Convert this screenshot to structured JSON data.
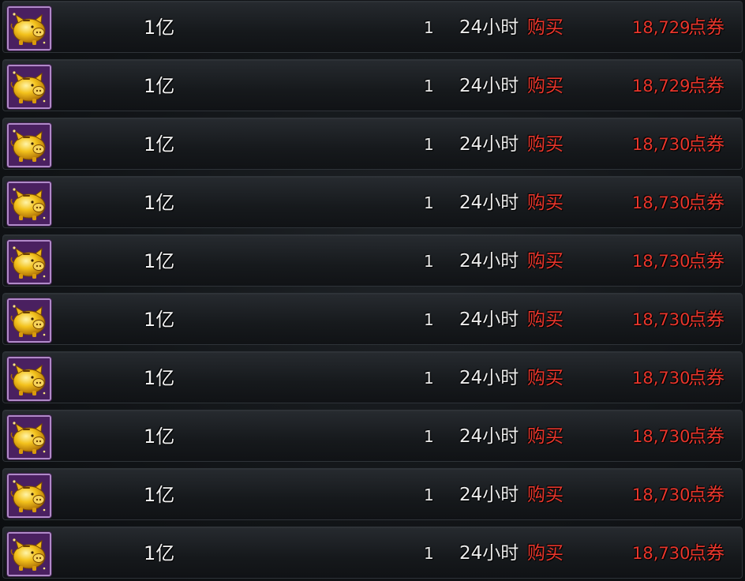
{
  "colors": {
    "accent": "#e8362c",
    "text": "#f2f2f2",
    "icon_border": "#b089c8"
  },
  "rows": [
    {
      "icon": "golden-pig-icon",
      "name": "1亿",
      "quantity": "1",
      "duration": "24小时",
      "buy_label": "购买",
      "price": "18,729",
      "currency": "点券"
    },
    {
      "icon": "golden-pig-icon",
      "name": "1亿",
      "quantity": "1",
      "duration": "24小时",
      "buy_label": "购买",
      "price": "18,729",
      "currency": "点券"
    },
    {
      "icon": "golden-pig-icon",
      "name": "1亿",
      "quantity": "1",
      "duration": "24小时",
      "buy_label": "购买",
      "price": "18,730",
      "currency": "点券"
    },
    {
      "icon": "golden-pig-icon",
      "name": "1亿",
      "quantity": "1",
      "duration": "24小时",
      "buy_label": "购买",
      "price": "18,730",
      "currency": "点券"
    },
    {
      "icon": "golden-pig-icon",
      "name": "1亿",
      "quantity": "1",
      "duration": "24小时",
      "buy_label": "购买",
      "price": "18,730",
      "currency": "点券"
    },
    {
      "icon": "golden-pig-icon",
      "name": "1亿",
      "quantity": "1",
      "duration": "24小时",
      "buy_label": "购买",
      "price": "18,730",
      "currency": "点券"
    },
    {
      "icon": "golden-pig-icon",
      "name": "1亿",
      "quantity": "1",
      "duration": "24小时",
      "buy_label": "购买",
      "price": "18,730",
      "currency": "点券"
    },
    {
      "icon": "golden-pig-icon",
      "name": "1亿",
      "quantity": "1",
      "duration": "24小时",
      "buy_label": "购买",
      "price": "18,730",
      "currency": "点券"
    },
    {
      "icon": "golden-pig-icon",
      "name": "1亿",
      "quantity": "1",
      "duration": "24小时",
      "buy_label": "购买",
      "price": "18,730",
      "currency": "点券"
    },
    {
      "icon": "golden-pig-icon",
      "name": "1亿",
      "quantity": "1",
      "duration": "24小时",
      "buy_label": "购买",
      "price": "18,730",
      "currency": "点券"
    }
  ]
}
